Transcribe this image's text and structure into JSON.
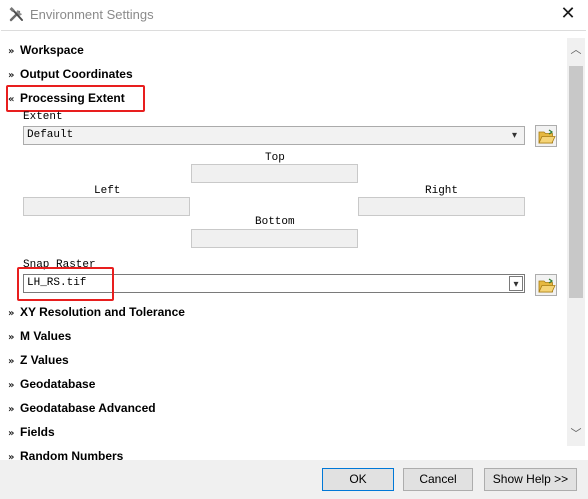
{
  "window": {
    "title": "Environment Settings",
    "close_glyph": "✕",
    "icon": "tools-icon"
  },
  "sections": {
    "workspace": {
      "label": "Workspace",
      "state": "collapsed"
    },
    "output_coordinates": {
      "label": "Output Coordinates",
      "state": "collapsed"
    },
    "processing_extent": {
      "label": "Processing Extent",
      "state": "expanded",
      "highlighted": true
    },
    "xy_resolution": {
      "label": "XY Resolution and Tolerance",
      "state": "collapsed"
    },
    "m_values": {
      "label": "M Values",
      "state": "collapsed"
    },
    "z_values": {
      "label": "Z Values",
      "state": "collapsed"
    },
    "geodatabase": {
      "label": "Geodatabase",
      "state": "collapsed"
    },
    "geodatabase_advanced": {
      "label": "Geodatabase Advanced",
      "state": "collapsed"
    },
    "fields": {
      "label": "Fields",
      "state": "collapsed"
    },
    "random_numbers": {
      "label": "Random Numbers",
      "state": "collapsed"
    }
  },
  "processing_extent": {
    "extent_label": "Extent",
    "extent_value": "Default",
    "top_label": "Top",
    "left_label": "Left",
    "right_label": "Right",
    "bottom_label": "Bottom",
    "top_value": "",
    "left_value": "",
    "right_value": "",
    "bottom_value": "",
    "snap_raster_label": "Snap Raster",
    "snap_raster_value": "LH_RS.tif",
    "snap_raster_highlighted": true
  },
  "glyphs": {
    "collapsed": "»",
    "expanded": "«",
    "dropdown": "▾",
    "scroll_up": "︿",
    "scroll_down": "﹀"
  },
  "buttons": {
    "ok": "OK",
    "cancel": "Cancel",
    "show_help": "Show Help >>"
  },
  "colors": {
    "highlight": "#e81e1e",
    "title_text": "#8a8a8a",
    "footer_bg": "#f0f0f0",
    "primary_border": "#0078d7"
  }
}
